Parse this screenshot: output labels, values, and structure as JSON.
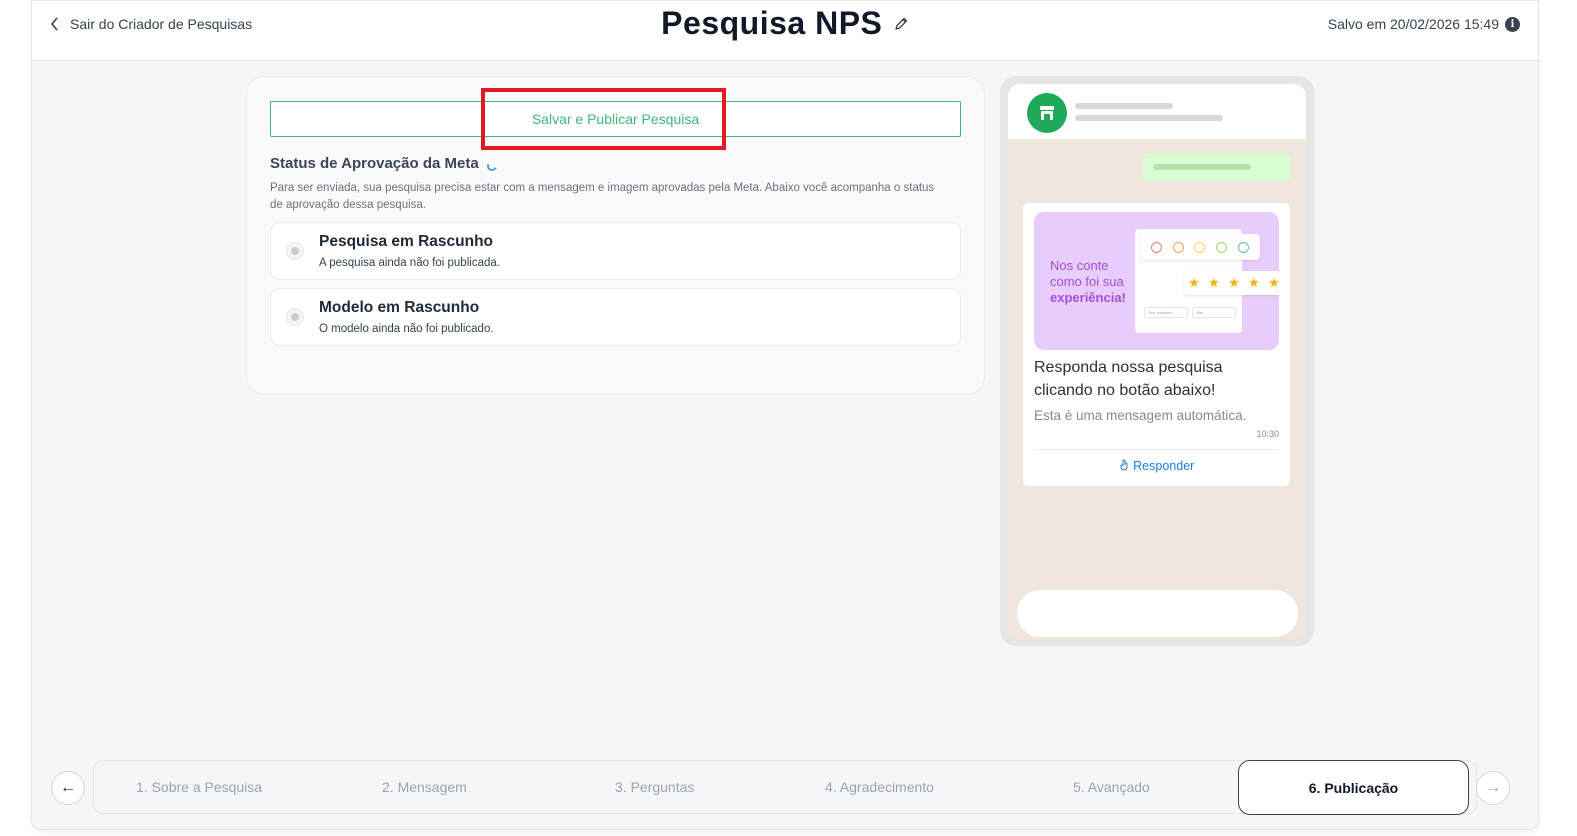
{
  "header": {
    "back_label": "Sair do Criador de Pesquisas",
    "title": "Pesquisa NPS",
    "saved_text": "Salvo em 20/02/2026 15:49",
    "info_icon_glyph": "i"
  },
  "publish": {
    "button_label": "Salvar e Publicar Pesquisa",
    "accent_color": "#3cb878"
  },
  "approval": {
    "title": "Status de Aprovação da Meta",
    "description": "Para ser enviada, sua pesquisa precisa estar com a mensagem e imagem aprovadas pela Meta. Abaixo você acompanha o status de aprovação dessa pesquisa.",
    "items": [
      {
        "title": "Pesquisa em Rascunho",
        "subtitle": "A pesquisa ainda não foi publicada."
      },
      {
        "title": "Modelo em Rascunho",
        "subtitle": "O modelo ainda não foi publicado."
      }
    ]
  },
  "preview": {
    "image_text_line1": "Nos conte",
    "image_text_line2": "como foi sua",
    "image_text_bold": "experiência!",
    "message": "Responda nossa pesquisa clicando no botão abaixo!",
    "footer": "Esta é uma mensagem automática.",
    "time": "10:30",
    "reply_label": "Responder",
    "mini_yes": "Sim, recebido",
    "mini_no": "Não",
    "brand_green": "#1faa59"
  },
  "steps": {
    "prev_glyph": "←",
    "next_glyph": "→",
    "items": [
      "1. Sobre a Pesquisa",
      "2. Mensagem",
      "3. Perguntas",
      "4. Agradecimento",
      "5. Avançado",
      "6. Publicação"
    ],
    "active_index": 5
  }
}
